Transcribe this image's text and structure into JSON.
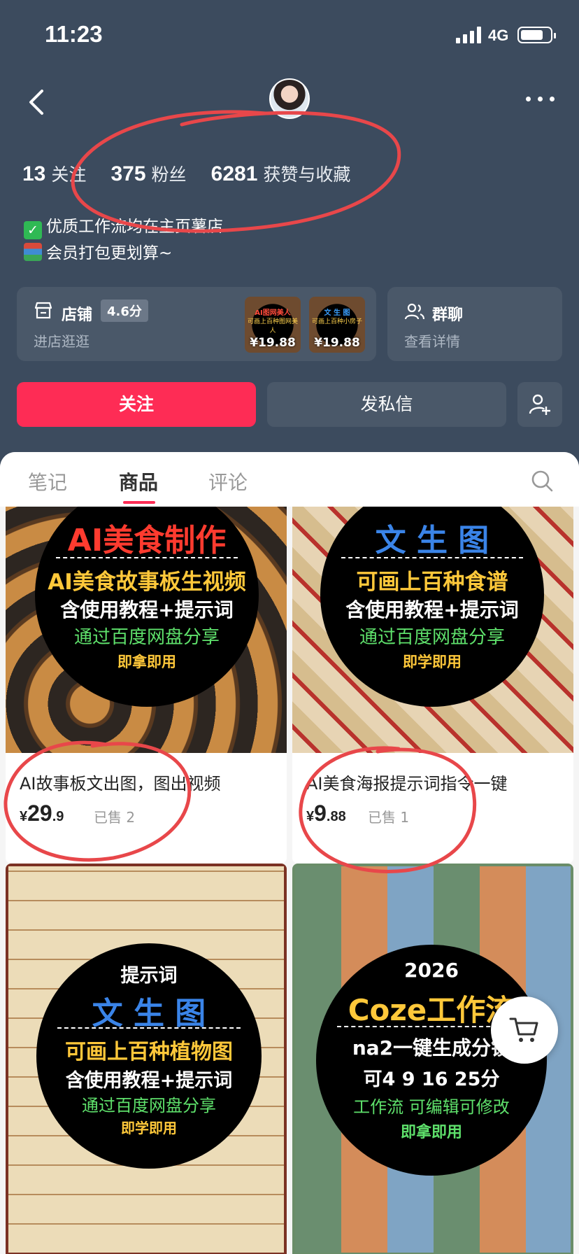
{
  "status_bar": {
    "time": "11:23",
    "network": "4G"
  },
  "profile": {
    "stats": [
      {
        "value": "13",
        "label": "关注"
      },
      {
        "value": "375",
        "label": "粉丝"
      },
      {
        "value": "6281",
        "label": "获赞与收藏"
      }
    ],
    "bio": [
      "优质工作流均在主页薯店",
      "会员打包更划算~"
    ]
  },
  "shop": {
    "title": "店铺",
    "rating": "4.6分",
    "subtitle": "进店逛逛",
    "thumbs": [
      {
        "line1": "AI图网美人",
        "line2": "可画上百种图网美人",
        "price": "¥19.88"
      },
      {
        "line1": "文 生 图",
        "line2": "可画上百种小房子",
        "price": "¥19.88"
      }
    ]
  },
  "group": {
    "title": "群聊",
    "subtitle": "查看详情"
  },
  "actions": {
    "follow": "关注",
    "message": "发私信"
  },
  "tabs": [
    "笔记",
    "商品",
    "评论"
  ],
  "products": [
    {
      "circle": [
        "AI美食制作",
        "AI美食故事板生视频",
        "含使用教程+提示词",
        "通过百度网盘分享",
        "即拿即用"
      ],
      "title": "AI故事板文出图，图出视频",
      "price_currency": "¥",
      "price_int": "29",
      "price_dec": ".9",
      "sold": "已售 2"
    },
    {
      "circle": [
        "文  生  图",
        "可画上百种食谱",
        "含使用教程+提示词",
        "通过百度网盘分享",
        "即学即用"
      ],
      "title": "AI美食海报提示词指令一键",
      "price_currency": "¥",
      "price_int": "9",
      "price_dec": ".88",
      "sold": "已售 1"
    },
    {
      "circle": [
        "提示词",
        "文  生  图",
        "可画上百种植物图",
        "含使用教程+提示词",
        "通过百度网盘分享",
        "即学即用"
      ]
    },
    {
      "circle": [
        "2026",
        "Coze工作流",
        "na2一键生成分镜",
        "可4 9 16 25分",
        "工作流 可编辑可修改",
        "即拿即用"
      ]
    }
  ],
  "colors": {
    "accent": "#fe2c55",
    "header_bg": "#3c4b5e",
    "annotation": "#e8474a"
  }
}
